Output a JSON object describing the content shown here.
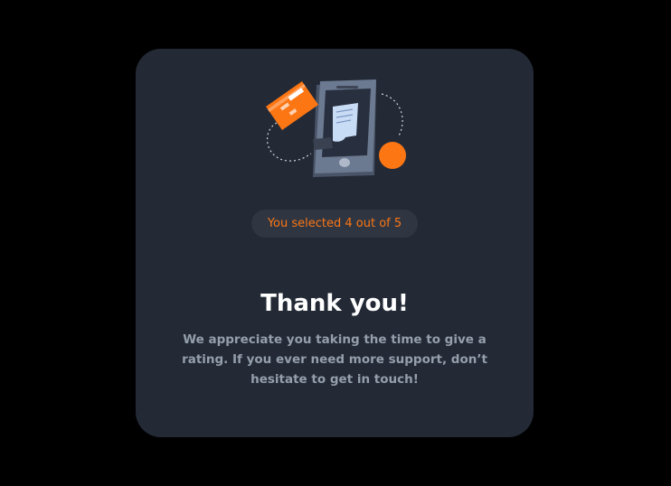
{
  "result": {
    "label": "You selected 4 out of 5",
    "selected": 4,
    "max": 5
  },
  "thanks": {
    "title": "Thank you!",
    "message": "We appreciate you taking the time to give a rating. If you ever need more support, don’t hesitate to get in touch!"
  },
  "colors": {
    "page_background": "#000000",
    "card_background": "#232a36",
    "accent": "#fc7614",
    "pill_background": "#2f3642",
    "title": "#ffffff",
    "body_text": "#959eac"
  },
  "icons": [
    "payment-illustration-icon"
  ]
}
